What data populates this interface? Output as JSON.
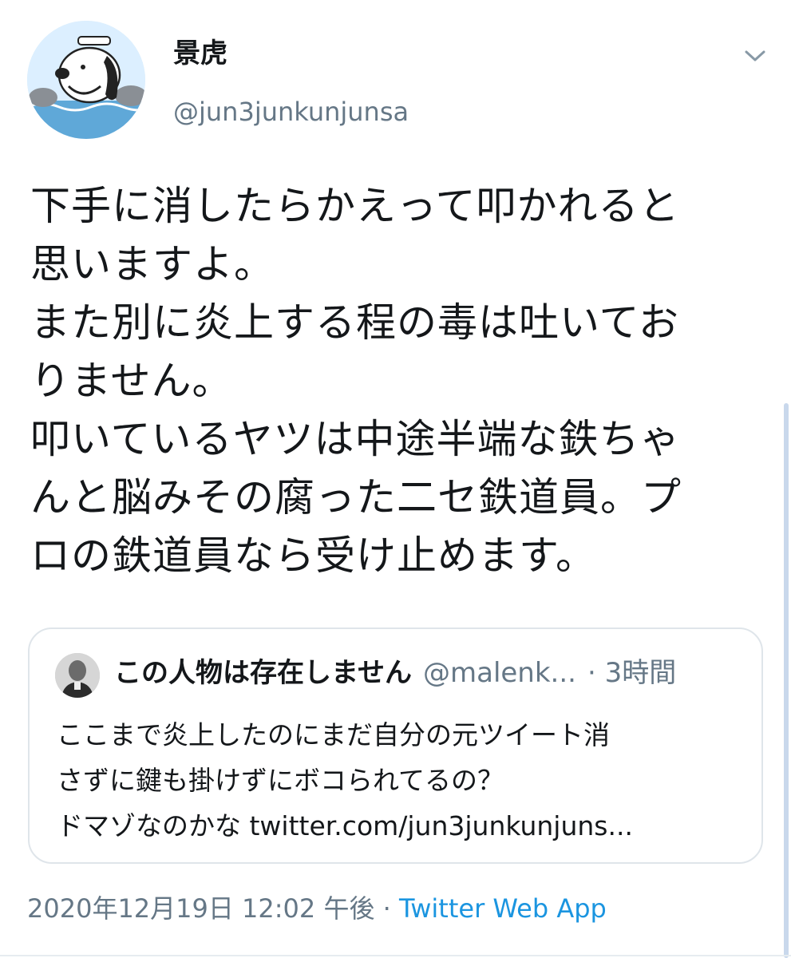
{
  "tweet": {
    "author": {
      "display_name": "景虎",
      "handle": "@jun3junkunjunsa",
      "avatar_icon": "snoopy-avatar-icon"
    },
    "menu_icon": "chevron-down-icon",
    "text_lines": [
      "下手に消したらかえって叩かれると",
      "思いますよ。",
      "また別に炎上する程の毒は吐いてお",
      "りません。",
      "叩いているヤツは中途半端な鉄ちゃ",
      "んと脳みその腐った二セ鉄道員。プ",
      "ロの鉄道員なら受け止めます。"
    ],
    "quoted_tweet": {
      "display_name": "この人物は存在しません",
      "handle": "@malenk...",
      "time": "· 3時間",
      "text_lines": [
        "ここまで炎上したのにまだ自分の元ツイート消",
        "さずに鍵も掛けずにボコられてるの？",
        "ドマゾなのかな twitter.com/jun3junkunjuns..."
      ]
    },
    "timestamp": "2020年12月19日 12:02 午後 · ",
    "source": "Twitter Web App"
  },
  "colors": {
    "text": "#14171a",
    "secondary": "#657786",
    "link": "#1b95e0",
    "border": "#dfe5ea"
  }
}
